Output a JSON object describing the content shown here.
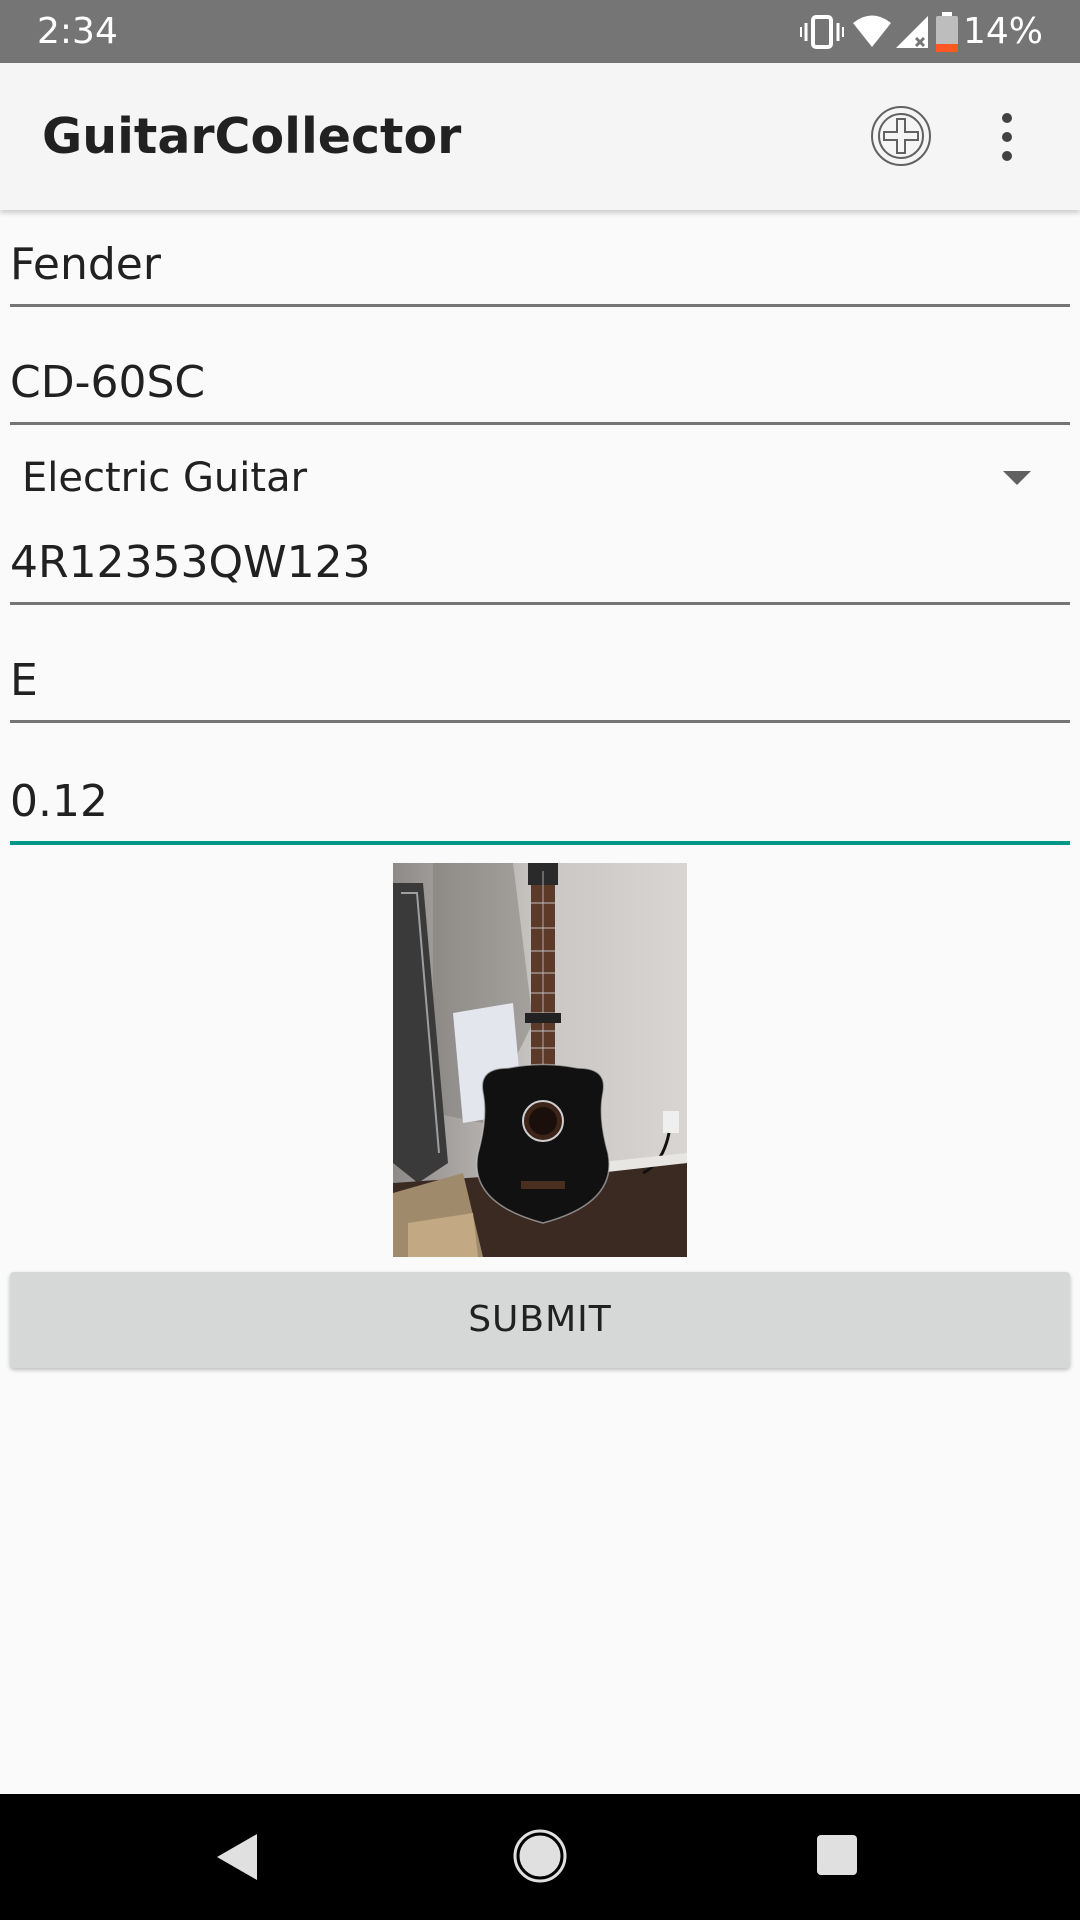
{
  "status_bar": {
    "time": "2:34",
    "battery_percent": "14%",
    "icons": [
      "vibrate-icon",
      "wifi-icon",
      "cellular-signal-icon",
      "battery-low-icon"
    ]
  },
  "app_bar": {
    "title": "GuitarCollector",
    "actions": [
      "add-circle-icon",
      "overflow-menu-icon"
    ]
  },
  "form": {
    "brand": "Fender",
    "model": "CD-60SC",
    "type_selected": "Electric Guitar",
    "serial": "4R12353QW123",
    "grade": "E",
    "value": "0.12",
    "active_field": "value"
  },
  "photo": {
    "description_icon": "guitar-photo"
  },
  "submit_label": "SUBMIT",
  "nav_bar": {
    "buttons": [
      "back-icon",
      "home-icon",
      "recents-icon"
    ]
  },
  "colors": {
    "status_bar": "#757575",
    "app_bar": "#f5f5f5",
    "accent": "#009688",
    "button": "#d6d7d7",
    "background": "#fafafa"
  }
}
